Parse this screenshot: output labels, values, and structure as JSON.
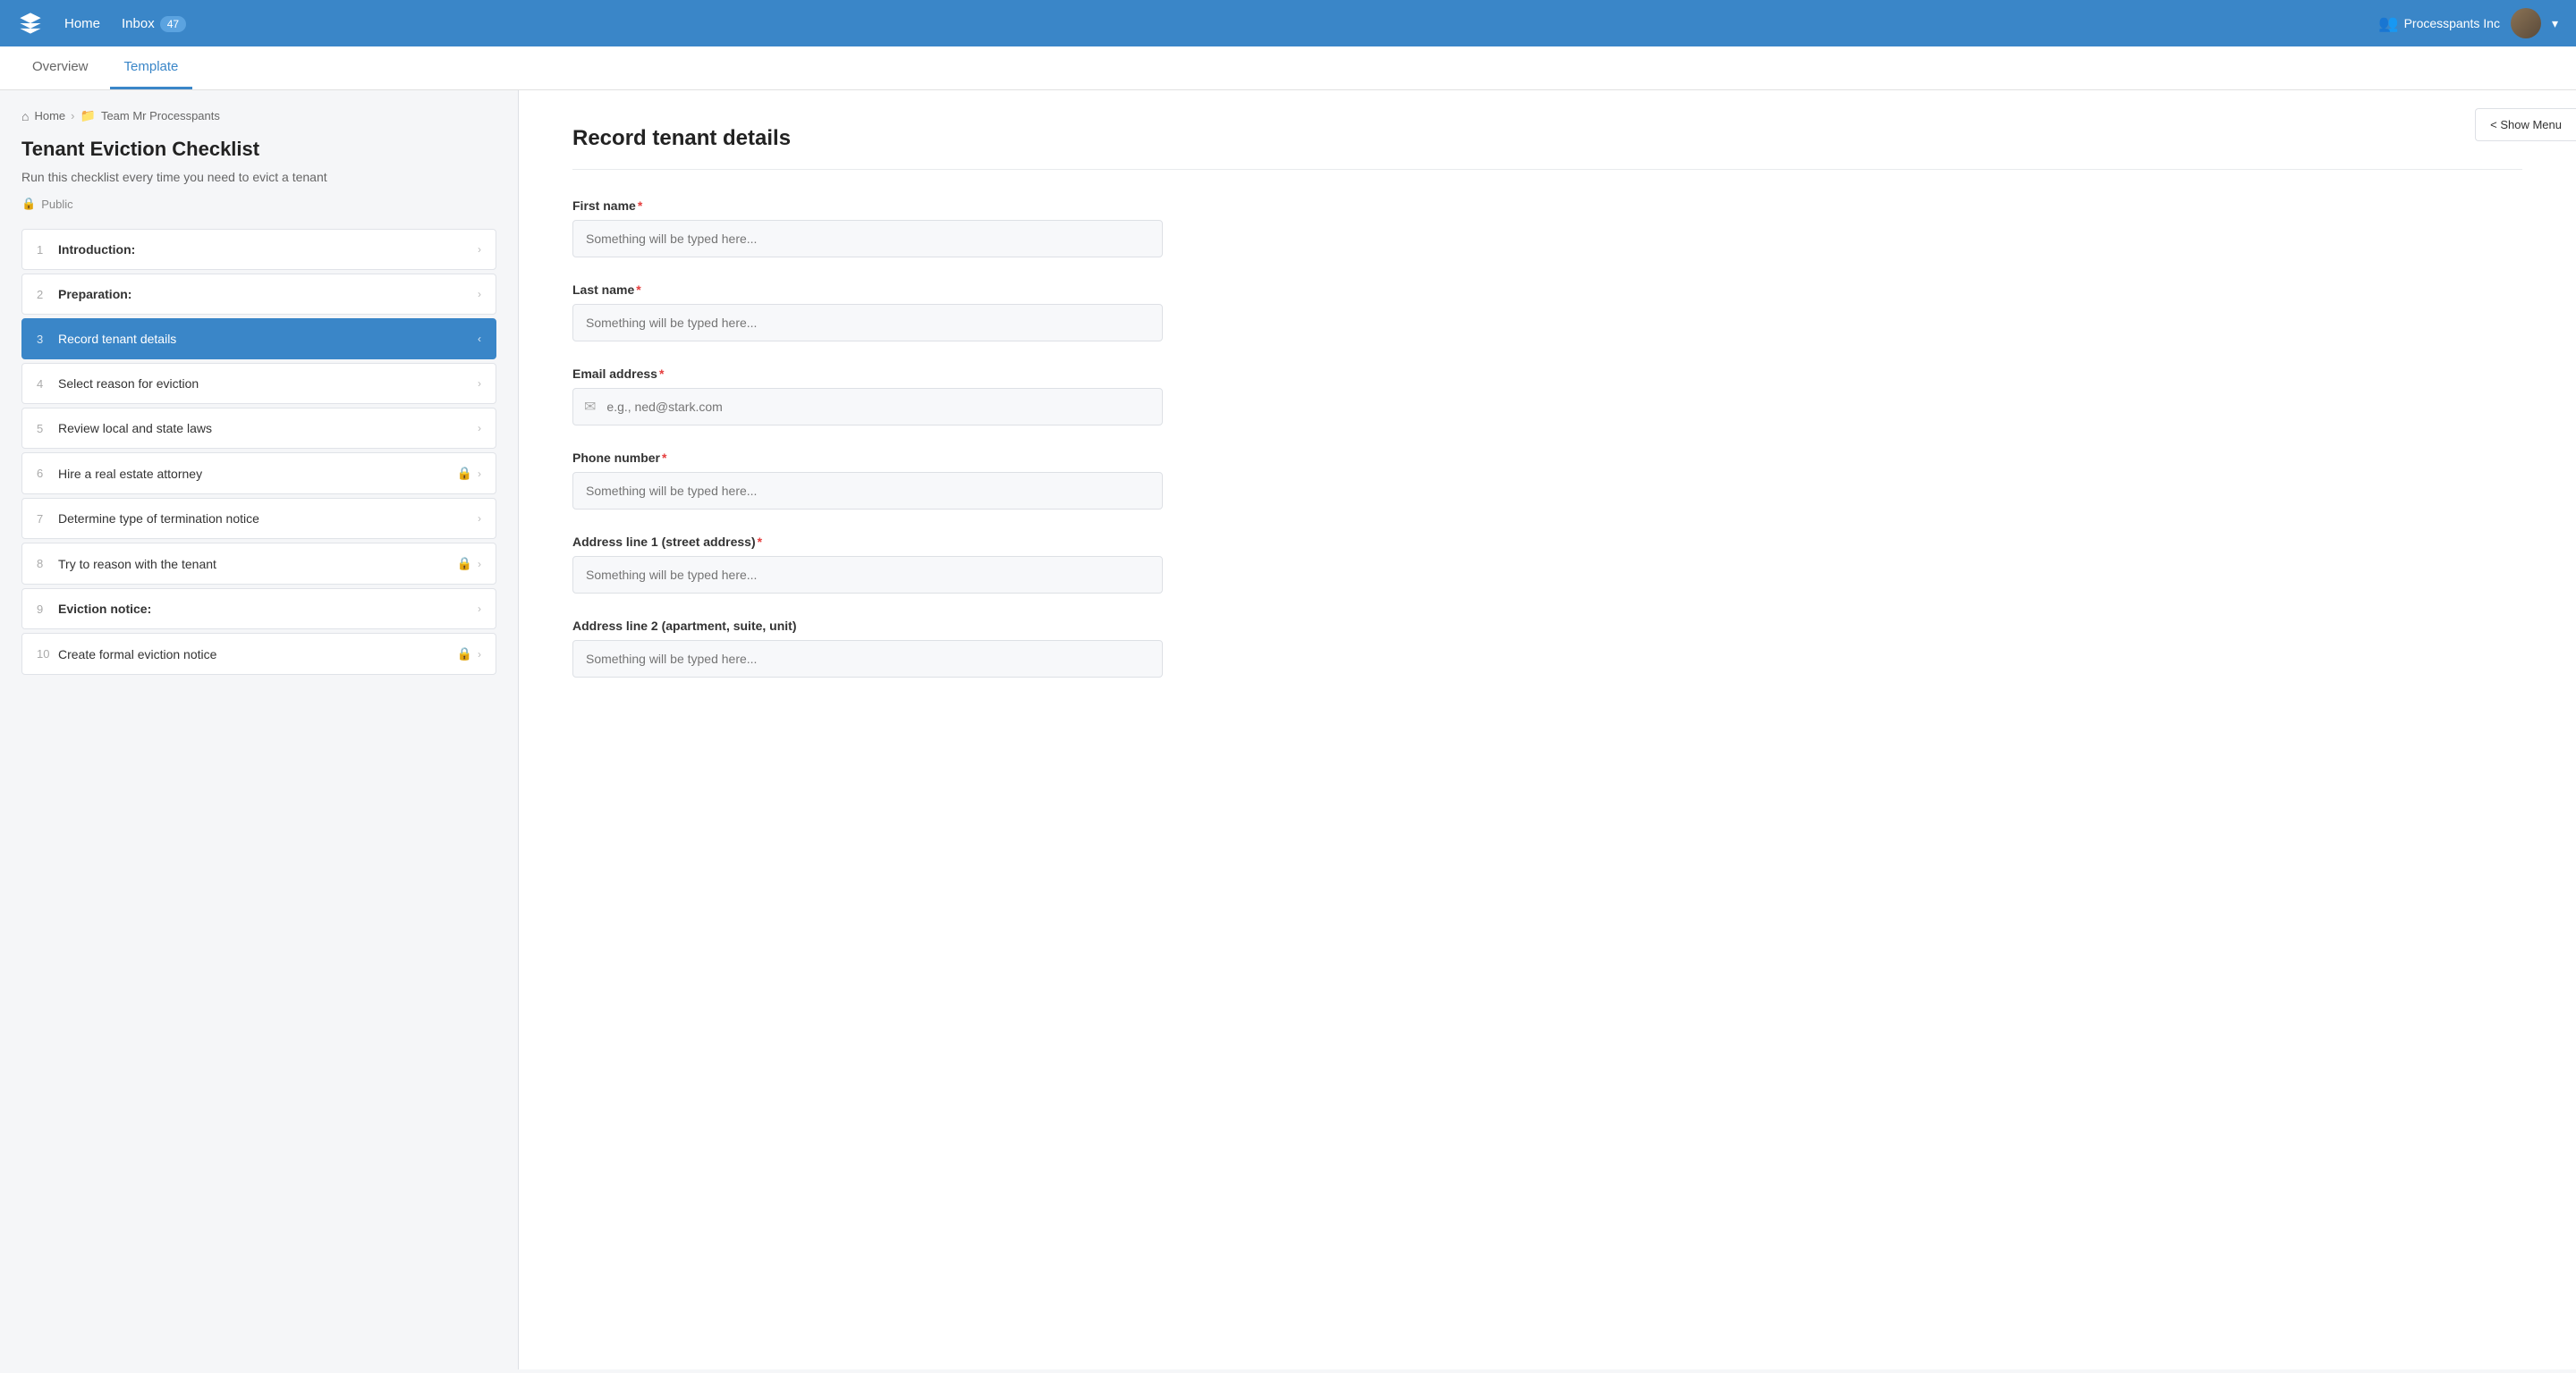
{
  "topnav": {
    "home_label": "Home",
    "inbox_label": "Inbox",
    "inbox_count": "47",
    "org_name": "Processpants Inc",
    "chevron_icon": "▾"
  },
  "tabs": [
    {
      "id": "overview",
      "label": "Overview",
      "active": false
    },
    {
      "id": "template",
      "label": "Template",
      "active": true
    }
  ],
  "breadcrumb": {
    "home_label": "Home",
    "team_label": "Team Mr Processpants"
  },
  "sidebar": {
    "title": "Tenant Eviction Checklist",
    "description": "Run this checklist every time you need to evict a tenant",
    "visibility": "Public",
    "items": [
      {
        "number": "1",
        "label": "Introduction:",
        "bold": true,
        "active": false,
        "locked": false
      },
      {
        "number": "2",
        "label": "Preparation:",
        "bold": true,
        "active": false,
        "locked": false
      },
      {
        "number": "3",
        "label": "Record tenant details",
        "bold": false,
        "active": true,
        "locked": false
      },
      {
        "number": "4",
        "label": "Select reason for eviction",
        "bold": false,
        "active": false,
        "locked": false
      },
      {
        "number": "5",
        "label": "Review local and state laws",
        "bold": false,
        "active": false,
        "locked": false
      },
      {
        "number": "6",
        "label": "Hire a real estate attorney",
        "bold": false,
        "active": false,
        "locked": true
      },
      {
        "number": "7",
        "label": "Determine type of termination notice",
        "bold": false,
        "active": false,
        "locked": false
      },
      {
        "number": "8",
        "label": "Try to reason with the tenant",
        "bold": false,
        "active": false,
        "locked": true
      },
      {
        "number": "9",
        "label": "Eviction notice:",
        "bold": true,
        "active": false,
        "locked": false
      },
      {
        "number": "10",
        "label": "Create formal eviction notice",
        "bold": false,
        "active": false,
        "locked": true
      }
    ]
  },
  "show_menu_label": "< Show Menu",
  "form": {
    "title": "Record tenant details",
    "fields": [
      {
        "id": "first_name",
        "label": "First name",
        "required": true,
        "type": "text",
        "placeholder": "Something will be typed here..."
      },
      {
        "id": "last_name",
        "label": "Last name",
        "required": true,
        "type": "text",
        "placeholder": "Something will be typed here..."
      },
      {
        "id": "email",
        "label": "Email address",
        "required": true,
        "type": "email",
        "placeholder": "e.g., ned@stark.com"
      },
      {
        "id": "phone",
        "label": "Phone number",
        "required": true,
        "type": "text",
        "placeholder": "Something will be typed here..."
      },
      {
        "id": "address1",
        "label": "Address line 1 (street address)",
        "required": true,
        "type": "text",
        "placeholder": "Something will be typed here..."
      },
      {
        "id": "address2",
        "label": "Address line 2 (apartment, suite, unit)",
        "required": false,
        "type": "text",
        "placeholder": "Something will be typed here..."
      }
    ]
  }
}
